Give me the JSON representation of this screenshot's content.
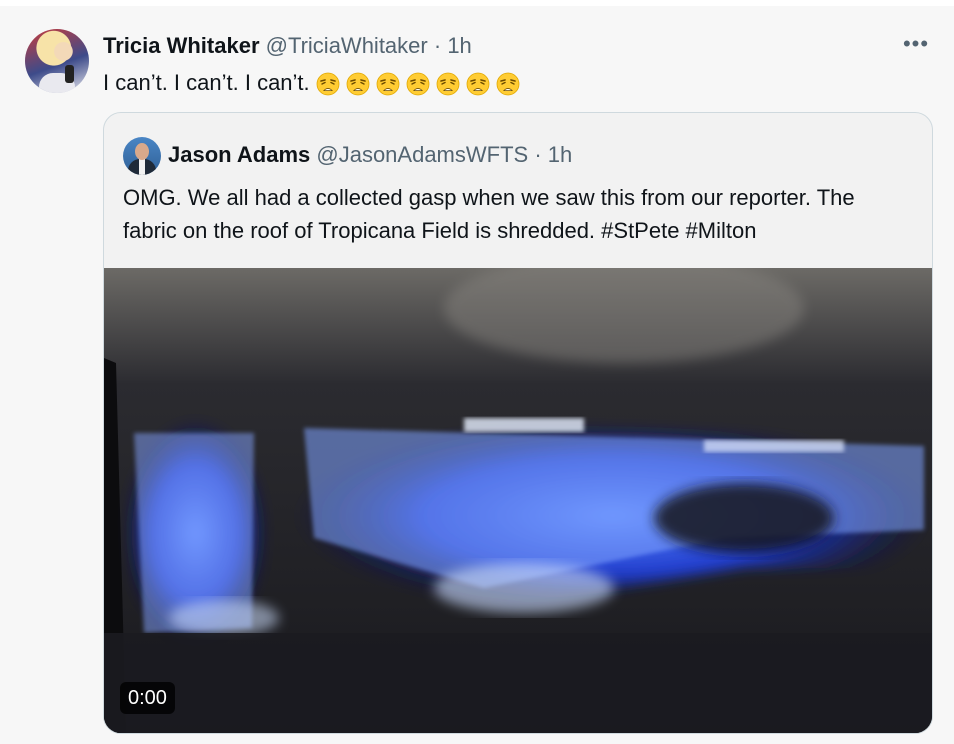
{
  "tweet": {
    "author_name": "Tricia Whitaker",
    "handle": "@TriciaWhitaker",
    "separator": "·",
    "time": "1h",
    "text": "I can’t. I can’t. I can’t.",
    "emoji_name": "weary-face-icon",
    "emoji_count": 7,
    "more_label": "•••"
  },
  "quote": {
    "author_name": "Jason Adams",
    "handle": "@JasonAdamsWFTS",
    "separator": "·",
    "time": "1h",
    "text": "OMG. We all had a collected gasp when we saw this from our reporter. The fabric on the roof of Tropicana Field is shredded. #StPete #Milton",
    "video_time": "0:00"
  }
}
